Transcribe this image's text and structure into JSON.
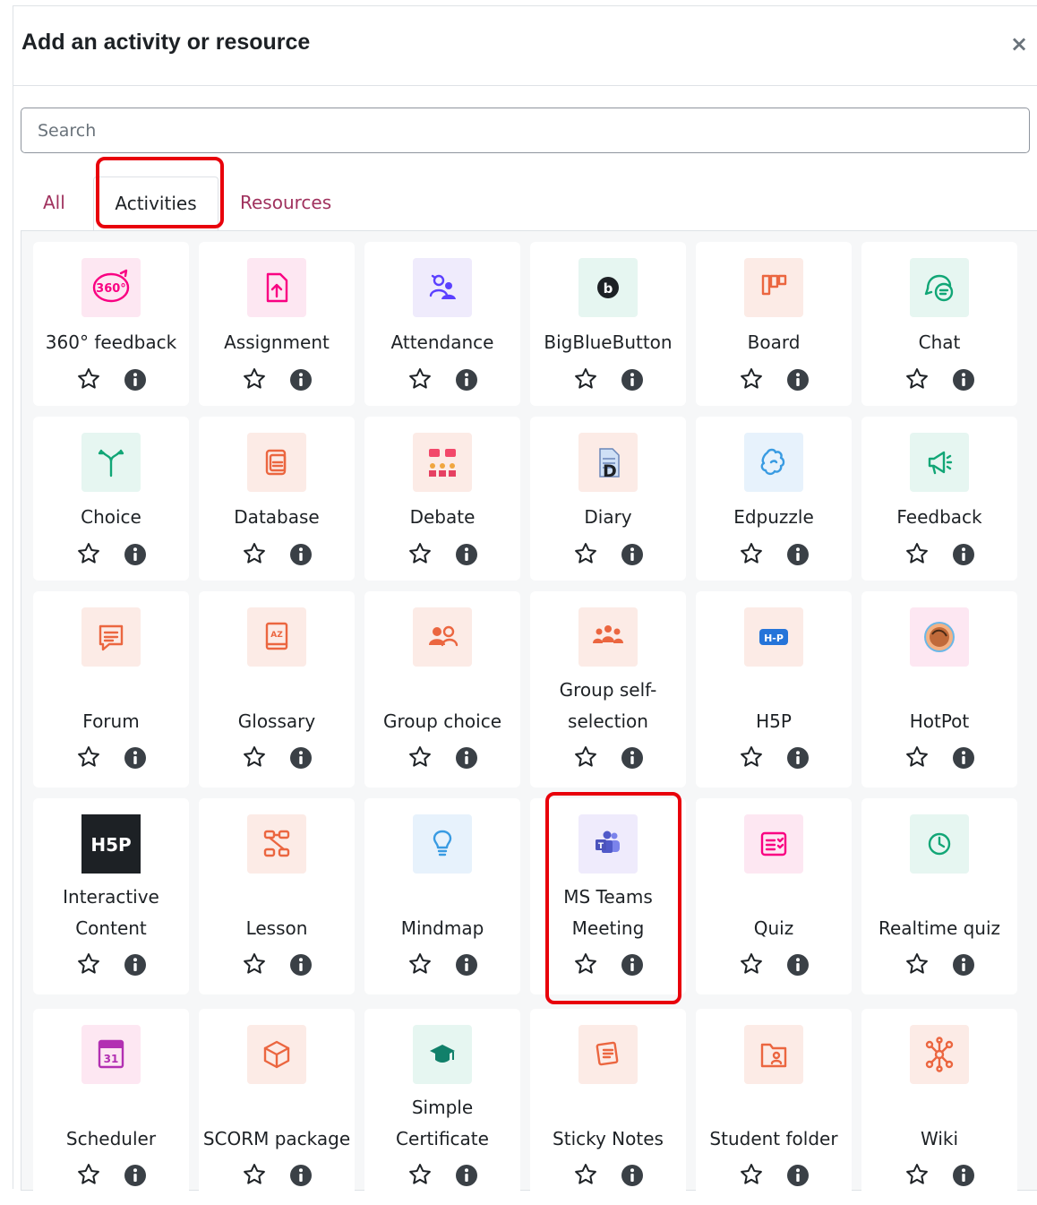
{
  "modal": {
    "title": "Add an activity or resource",
    "close_label": "×"
  },
  "search": {
    "placeholder": "Search",
    "value": ""
  },
  "tabs": [
    {
      "label": "All",
      "active": false
    },
    {
      "label": "Activities",
      "active": true
    },
    {
      "label": "Resources",
      "active": false
    }
  ],
  "colors": {
    "assessment": "#f90082",
    "collaboration": "#5b40ff",
    "communication": "#eb6640",
    "content": "#399be2",
    "interactive": "#1d2125",
    "administration": "#11a676",
    "tab_link": "#a0325e",
    "highlight": "#e8000b"
  },
  "activities": [
    {
      "label": "360° feedback",
      "icon": "feedback-360-icon",
      "category": "assessment"
    },
    {
      "label": "Assignment",
      "icon": "assignment-icon",
      "category": "assessment"
    },
    {
      "label": "Attendance",
      "icon": "attendance-icon",
      "category": "collaboration"
    },
    {
      "label": "BigBlueButton",
      "icon": "bigbluebutton-icon",
      "category": "administration"
    },
    {
      "label": "Board",
      "icon": "board-icon",
      "category": "communication"
    },
    {
      "label": "Chat",
      "icon": "chat-icon",
      "category": "administration"
    },
    {
      "label": "Choice",
      "icon": "choice-icon",
      "category": "administration"
    },
    {
      "label": "Database",
      "icon": "database-icon",
      "category": "communication"
    },
    {
      "label": "Debate",
      "icon": "debate-icon",
      "category": "communication"
    },
    {
      "label": "Diary",
      "icon": "diary-icon",
      "category": "communication"
    },
    {
      "label": "Edpuzzle",
      "icon": "edpuzzle-icon",
      "category": "content"
    },
    {
      "label": "Feedback",
      "icon": "feedback-megaphone-icon",
      "category": "administration"
    },
    {
      "label": "Forum",
      "icon": "forum-icon",
      "category": "communication"
    },
    {
      "label": "Glossary",
      "icon": "glossary-icon",
      "category": "communication"
    },
    {
      "label": "Group choice",
      "icon": "group-choice-icon",
      "category": "communication"
    },
    {
      "label": "Group self-selection",
      "icon": "group-self-selection-icon",
      "category": "communication"
    },
    {
      "label": "H5P",
      "icon": "h5p-icon",
      "category": "communication"
    },
    {
      "label": "HotPot",
      "icon": "hotpot-icon",
      "category": "assessment"
    },
    {
      "label": "Interactive Content",
      "icon": "interactive-content-icon",
      "category": "interactive"
    },
    {
      "label": "Lesson",
      "icon": "lesson-icon",
      "category": "communication"
    },
    {
      "label": "Mindmap",
      "icon": "mindmap-icon",
      "category": "content"
    },
    {
      "label": "MS Teams Meeting",
      "icon": "ms-teams-icon",
      "category": "collaboration"
    },
    {
      "label": "Quiz",
      "icon": "quiz-icon",
      "category": "assessment"
    },
    {
      "label": "Realtime quiz",
      "icon": "realtime-quiz-clock-icon",
      "category": "administration"
    },
    {
      "label": "Scheduler",
      "icon": "scheduler-calendar-icon",
      "category": "assessment"
    },
    {
      "label": "SCORM package",
      "icon": "scorm-package-icon",
      "category": "communication"
    },
    {
      "label": "Simple Certificate",
      "icon": "certificate-icon",
      "category": "administration"
    },
    {
      "label": "Sticky Notes",
      "icon": "sticky-notes-icon",
      "category": "communication"
    },
    {
      "label": "Student folder",
      "icon": "student-folder-icon",
      "category": "communication"
    },
    {
      "label": "Wiki",
      "icon": "wiki-icon",
      "category": "communication"
    }
  ]
}
